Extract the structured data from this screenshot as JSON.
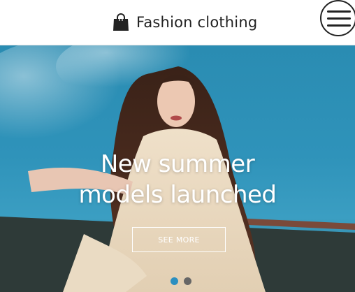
{
  "header": {
    "brand_icon": "shopping-bag-icon",
    "title": "Fashion clothing",
    "menu_icon": "hamburger-menu-icon"
  },
  "hero": {
    "headline_line1": "New summer",
    "headline_line2": "models launched",
    "cta_label": "SEE MORE",
    "slides": [
      {
        "active": true,
        "color": "#2b8fc0"
      },
      {
        "active": false,
        "color": "#666666"
      }
    ]
  },
  "colors": {
    "text_dark": "#222222",
    "hero_sky": "#2f93ba",
    "dot_active": "#2b8fc0",
    "dot_inactive": "#666666"
  }
}
